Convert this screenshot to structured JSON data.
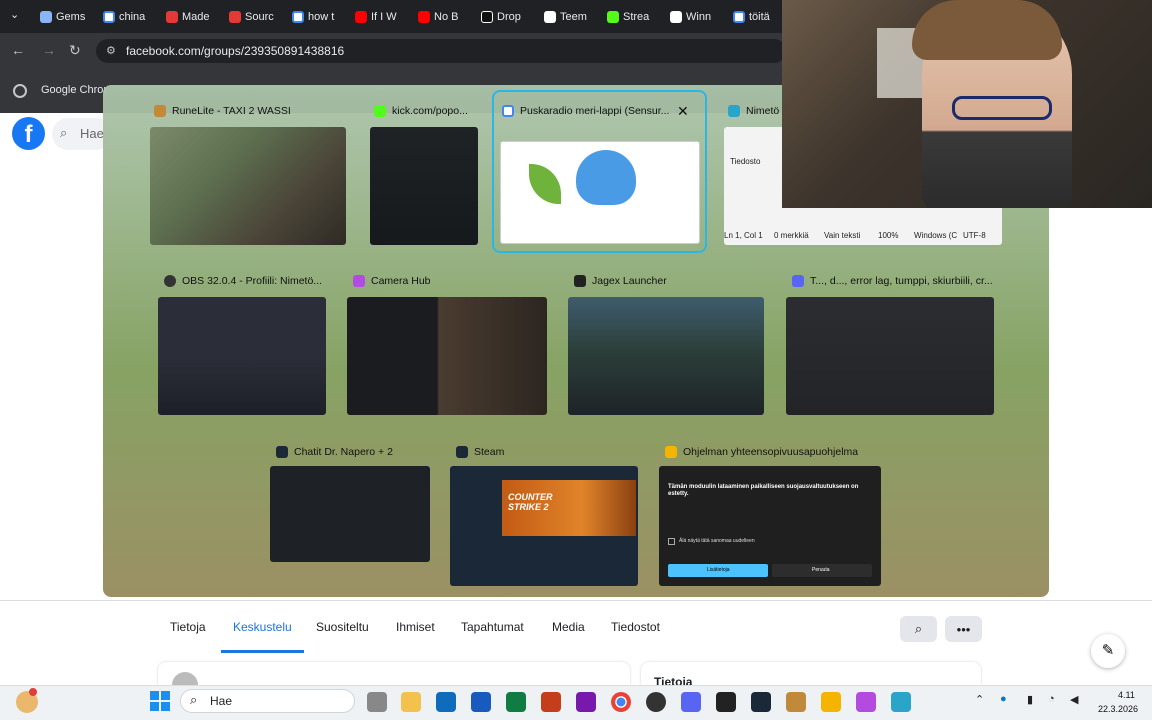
{
  "browser": {
    "tabs": [
      {
        "label": "Gems",
        "color": "#8ab4f8"
      },
      {
        "label": "china",
        "color": "#ffffff"
      },
      {
        "label": "Made",
        "color": "#e53935"
      },
      {
        "label": "Sourc",
        "color": "#e53935"
      },
      {
        "label": "how t",
        "color": "#ffffff"
      },
      {
        "label": "If I W",
        "color": "#ff0000"
      },
      {
        "label": "No B",
        "color": "#ff0000"
      },
      {
        "label": "Drop",
        "color": "#ffffff"
      },
      {
        "label": "Teem",
        "color": "#ffffff"
      },
      {
        "label": "Strea",
        "color": "#53fc18"
      },
      {
        "label": "Winn",
        "color": "#ffffff"
      },
      {
        "label": "töitä",
        "color": "#ffffff"
      }
    ],
    "url": "facebook.com/groups/239350891438816",
    "bookmark": "Google Chror"
  },
  "facebook": {
    "logo": "f",
    "search_placeholder": "Hae",
    "tabs": [
      "Tietoja",
      "Keskustelu",
      "Suositeltu",
      "Ihmiset",
      "Tapahtumat",
      "Media",
      "Tiedostot"
    ],
    "active_tab": "Keskustelu",
    "bottom_right_heading": "Tietoja"
  },
  "switcher": {
    "windows": [
      {
        "title": "RuneLite - TAXI 2 WASSI",
        "icon_color": "#c08a3a"
      },
      {
        "title": "kick.com/popo...",
        "icon_color": "#53fc18"
      },
      {
        "title": "Puskaradio meri-lappi (Sensur...",
        "icon_color": "#4285f4"
      },
      {
        "title": "Nimetö",
        "icon_color": "#2aa5c9"
      },
      {
        "title": "OBS 32.0.4 - Profiili: Nimetö...",
        "icon_color": "#333333"
      },
      {
        "title": "Camera Hub",
        "icon_color": "#b44be1"
      },
      {
        "title": "Jagex Launcher",
        "icon_color": "#222222"
      },
      {
        "title": "T..., d..., error lag, tumppi, skiurbiili, cr...",
        "icon_color": "#5865f2"
      },
      {
        "title": "Chatit Dr. Napero + 2",
        "icon_color": "#1b2838"
      },
      {
        "title": "Steam",
        "icon_color": "#1b2838"
      },
      {
        "title": "Ohjelman yhteensopivuusapuohjelma",
        "icon_color": "#f5b400"
      }
    ],
    "notepad_tab": "Tiedosto",
    "notepad_status": [
      "Ln 1, Col 1",
      "0 merkkiä",
      "Vain teksti",
      "100%",
      "Windows (C",
      "UTF-8"
    ],
    "steam_banner": "COUNTER STRIKE 2",
    "compat_dialog": {
      "body": "Tämän moduulin lataaminen paikalliseen suojausvaltuutukseen on estetty.",
      "checkbox": "Älä näytä tätä sanomaa uudelleen",
      "primary": "Lisätietoja",
      "secondary": "Peruuta"
    }
  },
  "taskbar": {
    "search": "Hae",
    "time": "4.11",
    "date": "22.3.2026"
  }
}
